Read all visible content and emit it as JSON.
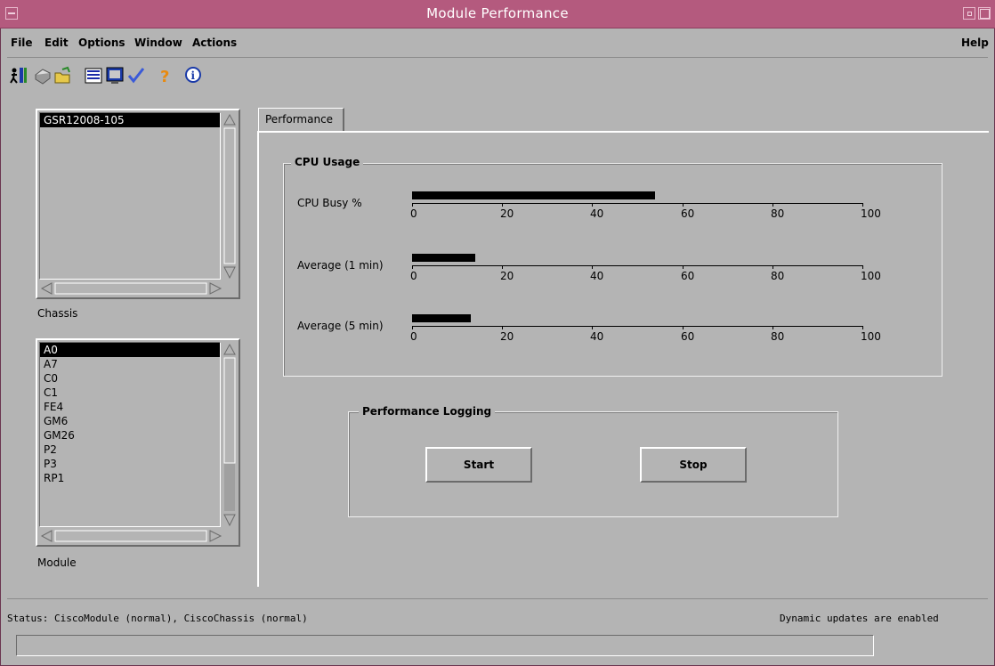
{
  "window": {
    "title": "Module Performance"
  },
  "menu": {
    "items": [
      {
        "label": "File"
      },
      {
        "label": "Edit"
      },
      {
        "label": "Options"
      },
      {
        "label": "Window"
      },
      {
        "label": "Actions"
      }
    ],
    "help": "Help"
  },
  "toolbar": {
    "icons": [
      "exit-icon",
      "print-icon",
      "open-folder-icon",
      "list-icon",
      "monitor-icon",
      "check-icon",
      "help-question-icon",
      "info-icon"
    ]
  },
  "chassis": {
    "label": "Chassis",
    "items": [
      "GSR12008-105"
    ],
    "selected": "GSR12008-105"
  },
  "module": {
    "label": "Module",
    "items": [
      "A0",
      "A7",
      "C0",
      "C1",
      "FE4",
      "GM6",
      "GM26",
      "P2",
      "P3",
      "RP1"
    ],
    "selected": "A0"
  },
  "tabs": [
    {
      "label": "Performance"
    }
  ],
  "cpu": {
    "title": "CPU Usage",
    "ticks": [
      "0",
      "20",
      "40",
      "60",
      "80",
      "100"
    ],
    "meters": [
      {
        "label": "CPU Busy %",
        "value": 54
      },
      {
        "label": "Average (1 min)",
        "value": 14
      },
      {
        "label": "Average (5 min)",
        "value": 13
      }
    ]
  },
  "logging": {
    "title": "Performance Logging",
    "start": "Start",
    "stop": "Stop"
  },
  "status": {
    "text": "Status: CiscoModule (normal), CiscoChassis (normal)",
    "right": "Dynamic updates are enabled"
  },
  "colors": {
    "titlebar": "#b45a7e",
    "background": "#b4b4b4"
  }
}
